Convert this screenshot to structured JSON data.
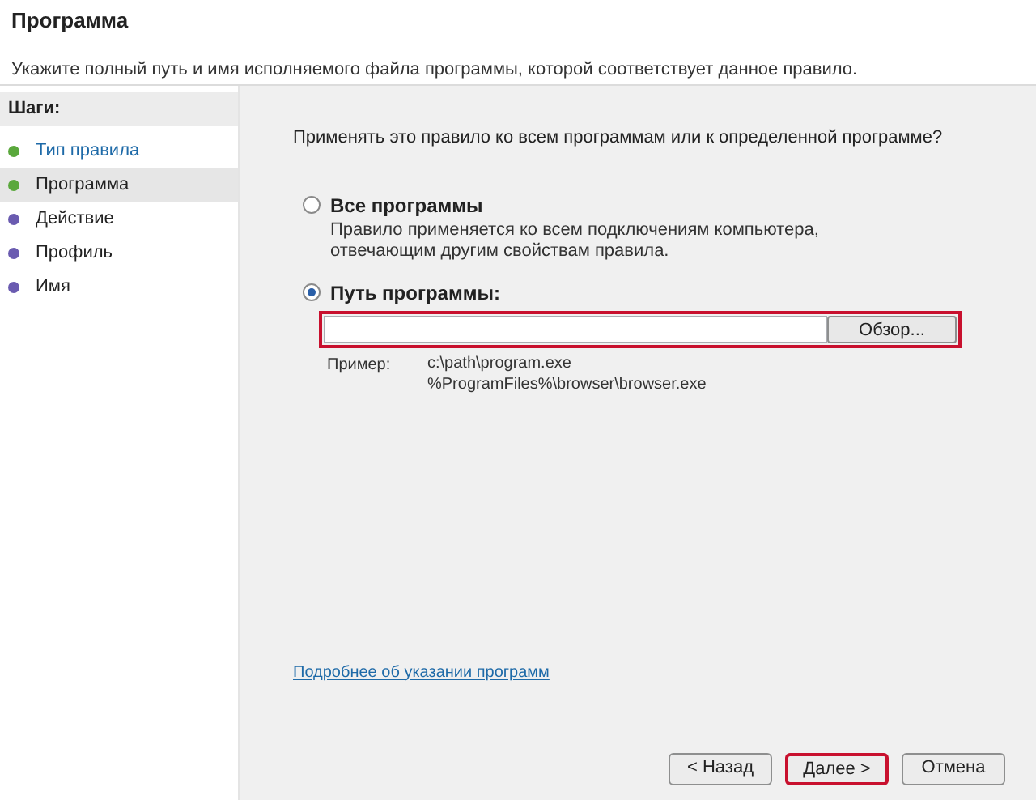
{
  "header": {
    "title": "Программа",
    "subtitle": "Укажите полный путь и имя исполняемого файла программы, которой соответствует данное правило."
  },
  "steps": {
    "title": "Шаги:",
    "items": [
      {
        "label": "Тип правила",
        "selected": false,
        "done": true,
        "color": "#5aa83c"
      },
      {
        "label": "Программа",
        "selected": true,
        "done": false,
        "color": "#5aa83c"
      },
      {
        "label": "Действие",
        "selected": false,
        "done": false,
        "color": "#6a5bb0"
      },
      {
        "label": "Профиль",
        "selected": false,
        "done": false,
        "color": "#6a5bb0"
      },
      {
        "label": "Имя",
        "selected": false,
        "done": false,
        "color": "#6a5bb0"
      }
    ]
  },
  "question": "Применять это правило ко всем программам или к определенной программе?",
  "options": [
    {
      "label": "Все программы",
      "selected": false,
      "description": "Правило применяется ко всем подключениям компьютера, отвечающим другим свойствам правила."
    },
    {
      "label": "Путь программы:",
      "selected": true
    }
  ],
  "path_field": {
    "highlighted": true
  },
  "browse_button": "Обзор...",
  "example": {
    "label": "Пример:",
    "lines": [
      "c:\\path\\program.exe",
      "%ProgramFiles%\\browser\\browser.exe"
    ]
  },
  "help_link": "Подробнее об указании программ",
  "buttons": [
    {
      "label": "< Назад",
      "highlighted": false
    },
    {
      "label": "Далее >",
      "highlighted": true
    },
    {
      "label": "Отмена",
      "highlighted": false
    }
  ]
}
